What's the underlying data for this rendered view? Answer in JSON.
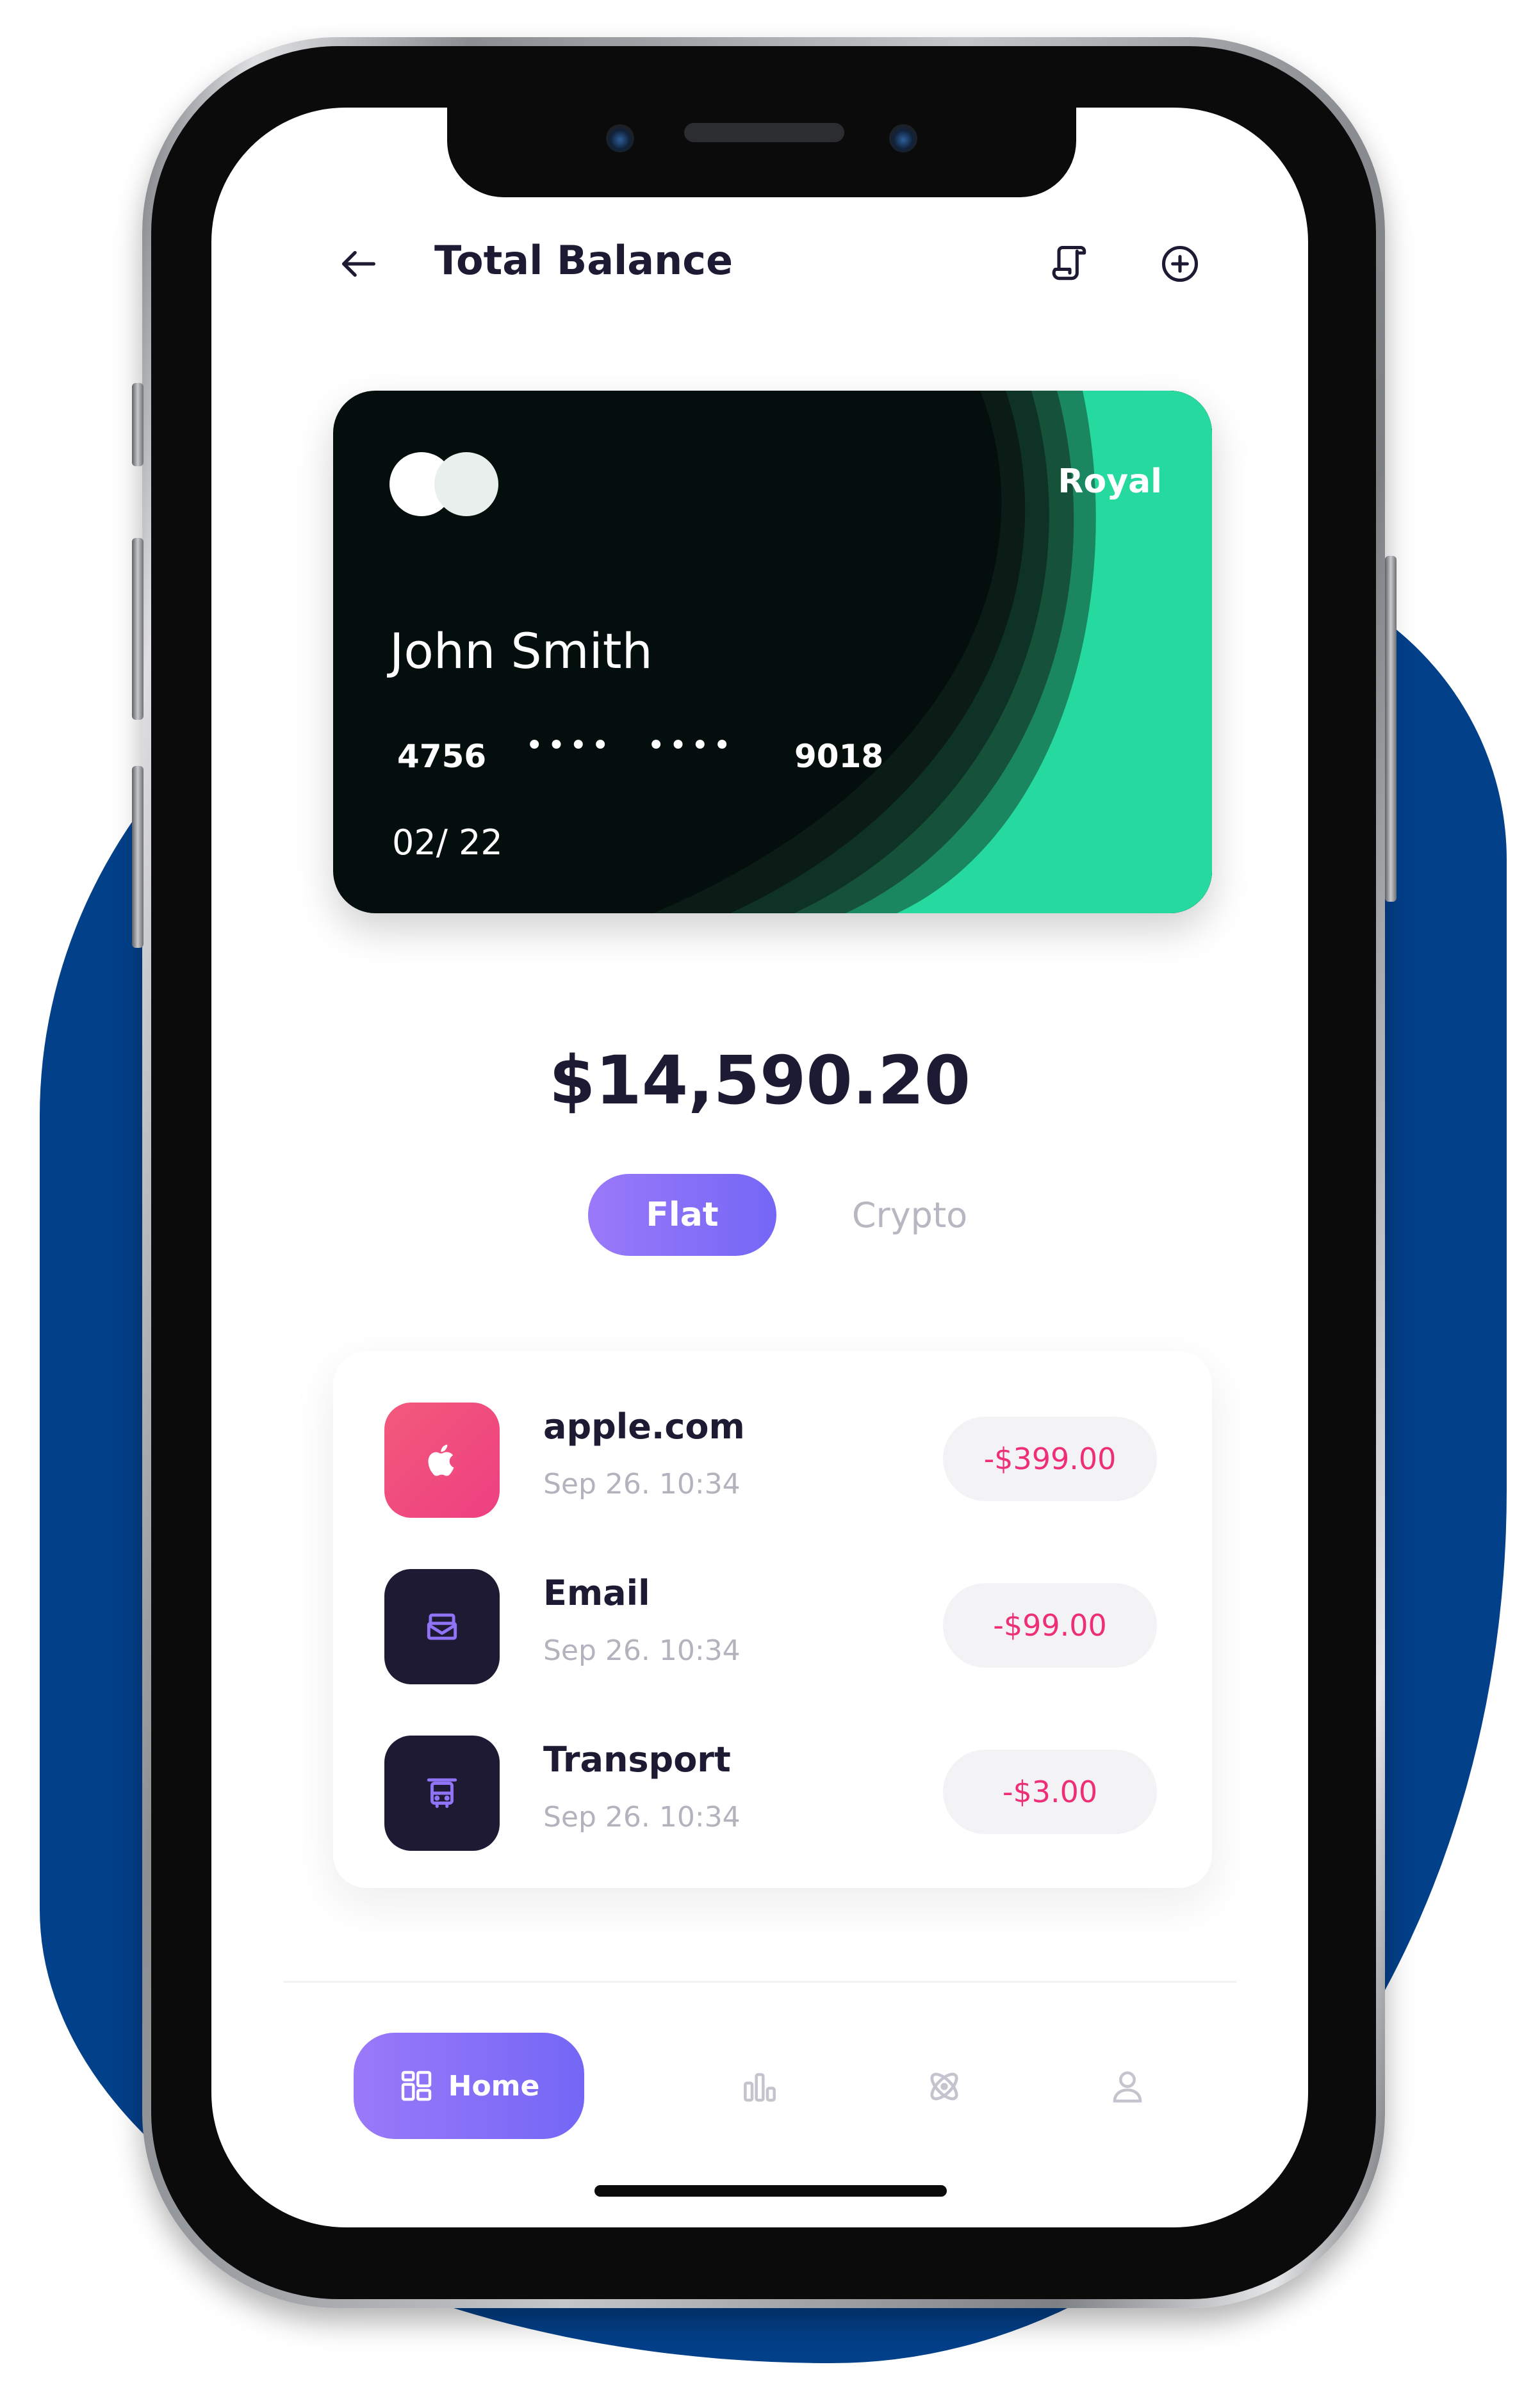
{
  "header": {
    "title": "Total Balance",
    "back_icon": "arrow-left-icon",
    "actions": [
      "receipt-icon",
      "plus-circle-icon"
    ]
  },
  "card": {
    "tier": "Royal",
    "holder": "John Smith",
    "number_start": "4756",
    "masked_group_1": "••••",
    "masked_group_2": "••••",
    "number_end": "9018",
    "expiry": "02/ 22",
    "logo": "card-network-logo",
    "colors": {
      "base": "#040f0d",
      "accent": "#25d99f"
    }
  },
  "balance": {
    "amount": "$14,590.20"
  },
  "tabs": [
    {
      "label": "Flat",
      "active": true
    },
    {
      "label": "Crypto",
      "active": false
    }
  ],
  "transactions": [
    {
      "name": "apple.com",
      "time": "Sep 26. 10:34",
      "amount": "-$399.00",
      "icon": "apple-icon",
      "color": "#f04a7c"
    },
    {
      "name": "Email",
      "time": "Sep 26. 10:34",
      "amount": "-$99.00",
      "icon": "mail-icon",
      "color": "#1f1a33"
    },
    {
      "name": "Transport",
      "time": "Sep 26. 10:34",
      "amount": "-$3.00",
      "icon": "bus-icon",
      "color": "#1f1a33"
    }
  ],
  "nav": {
    "home_label": "Home",
    "items": [
      "dashboard-icon",
      "stats-icon",
      "atom-icon",
      "user-icon"
    ]
  },
  "colors": {
    "background_blob": "#03408a",
    "accent_gradient": [
      "#9a79f9",
      "#7467f6"
    ],
    "amount_text": "#ee2f78"
  }
}
